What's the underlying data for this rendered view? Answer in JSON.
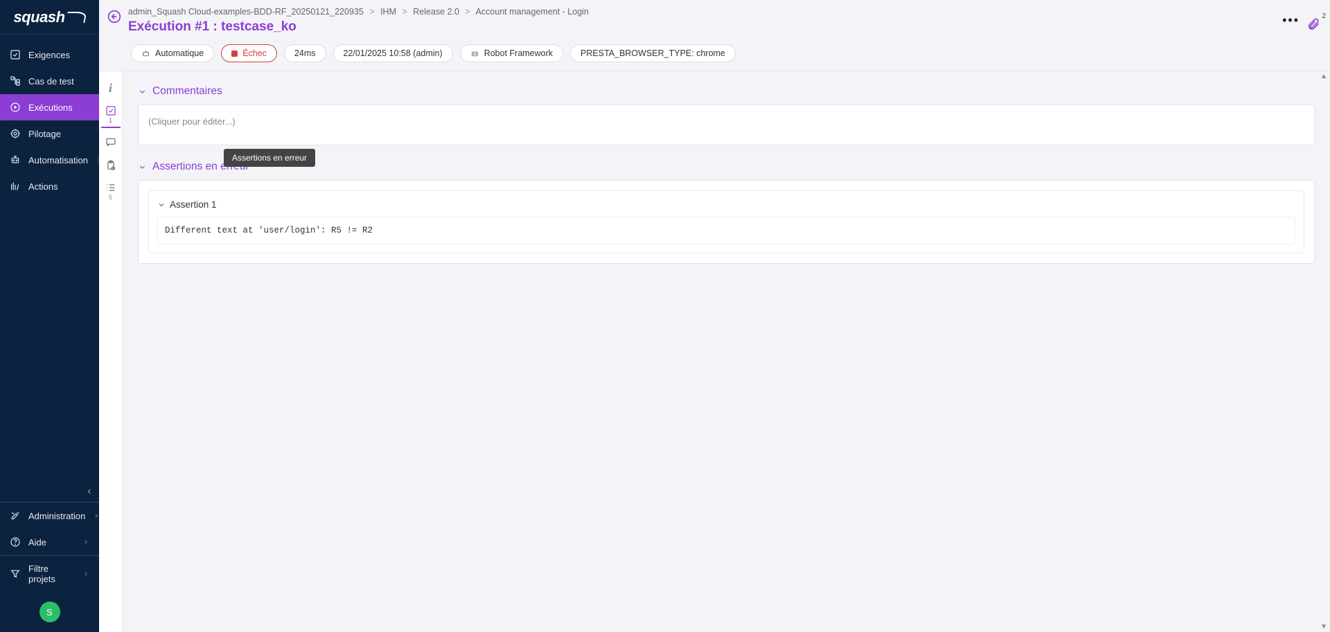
{
  "logo": "squash",
  "nav": {
    "exigences": "Exigences",
    "cas_de_test": "Cas de test",
    "executions": "Exécutions",
    "pilotage": "Pilotage",
    "automatisation": "Automatisation",
    "actions": "Actions",
    "administration": "Administration",
    "aide": "Aide",
    "filtre_projets": "Filtre projets",
    "avatar_letter": "S"
  },
  "breadcrumbs": [
    "admin_Squash Cloud-examples-BDD-RF_20250121_220935",
    "IHM",
    "Release 2.0",
    "Account management - Login"
  ],
  "page_title": "Exécution #1 : testcase_ko",
  "attach_count": "2",
  "pills": {
    "mode": "Automatique",
    "status": "Échec",
    "duration": "24ms",
    "timestamp": "22/01/2025 10:58 (admin)",
    "framework": "Robot Framework",
    "env": "PRESTA_BROWSER_TYPE: chrome"
  },
  "rail": {
    "check_badge": "1",
    "steps_badge": "5"
  },
  "tooltip": "Assertions en erreur",
  "sections": {
    "commentaires_title": "Commentaires",
    "commentaires_placeholder": "(Cliquer pour éditer...)",
    "assertions_title": "Assertions en erreur",
    "assertion1_title": "Assertion 1",
    "assertion1_msg": "Different text at 'user/login': R5 != R2"
  }
}
